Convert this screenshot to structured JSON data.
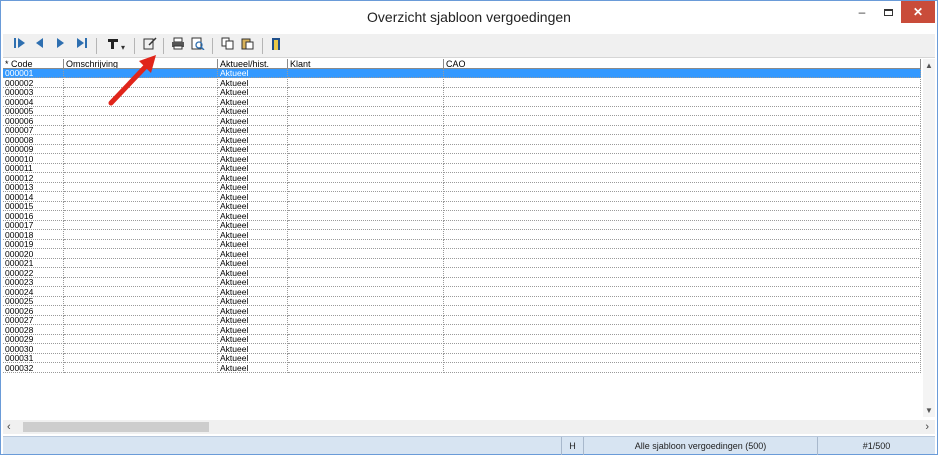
{
  "window": {
    "title": "Overzicht sjabloon vergoedingen"
  },
  "toolbar": {
    "first": "|◆",
    "prev": "◆",
    "next": "◆",
    "last": "◆|",
    "filter_arrow": "▾"
  },
  "columns": [
    "* Code",
    "Omschrijving",
    "Aktueel/hist.",
    "Klant",
    "CAO"
  ],
  "rows": [
    [
      "000001",
      "",
      "Aktueel",
      "",
      ""
    ],
    [
      "000002",
      "",
      "Aktueel",
      "",
      ""
    ],
    [
      "000003",
      "",
      "Aktueel",
      "",
      ""
    ],
    [
      "000004",
      "",
      "Aktueel",
      "",
      ""
    ],
    [
      "000005",
      "",
      "Aktueel",
      "",
      ""
    ],
    [
      "000006",
      "",
      "Aktueel",
      "",
      ""
    ],
    [
      "000007",
      "",
      "Aktueel",
      "",
      ""
    ],
    [
      "000008",
      "",
      "Aktueel",
      "",
      ""
    ],
    [
      "000009",
      "",
      "Aktueel",
      "",
      ""
    ],
    [
      "000010",
      "",
      "Aktueel",
      "",
      ""
    ],
    [
      "000011",
      "",
      "Aktueel",
      "",
      ""
    ],
    [
      "000012",
      "",
      "Aktueel",
      "",
      ""
    ],
    [
      "000013",
      "",
      "Aktueel",
      "",
      ""
    ],
    [
      "000014",
      "",
      "Aktueel",
      "",
      ""
    ],
    [
      "000015",
      "",
      "Aktueel",
      "",
      ""
    ],
    [
      "000016",
      "",
      "Aktueel",
      "",
      ""
    ],
    [
      "000017",
      "",
      "Aktueel",
      "",
      ""
    ],
    [
      "000018",
      "",
      "Aktueel",
      "",
      ""
    ],
    [
      "000019",
      "",
      "Aktueel",
      "",
      ""
    ],
    [
      "000020",
      "",
      "Aktueel",
      "",
      ""
    ],
    [
      "000021",
      "",
      "Aktueel",
      "",
      ""
    ],
    [
      "000022",
      "",
      "Aktueel",
      "",
      ""
    ],
    [
      "000023",
      "",
      "Aktueel",
      "",
      ""
    ],
    [
      "000024",
      "",
      "Aktueel",
      "",
      ""
    ],
    [
      "000025",
      "",
      "Aktueel",
      "",
      ""
    ],
    [
      "000026",
      "",
      "Aktueel",
      "",
      ""
    ],
    [
      "000027",
      "",
      "Aktueel",
      "",
      ""
    ],
    [
      "000028",
      "",
      "Aktueel",
      "",
      ""
    ],
    [
      "000029",
      "",
      "Aktueel",
      "",
      ""
    ],
    [
      "000030",
      "",
      "Aktueel",
      "",
      ""
    ],
    [
      "000031",
      "",
      "Aktueel",
      "",
      ""
    ],
    [
      "000032",
      "",
      "Aktueel",
      "",
      ""
    ]
  ],
  "statusbar": {
    "mode": "H",
    "description": "Alle sjabloon vergoedingen (500)",
    "position": "#1/500"
  },
  "colors": {
    "selection": "#3399ff",
    "close_button": "#c94c3a",
    "annotation_arrow": "#e0251b"
  }
}
